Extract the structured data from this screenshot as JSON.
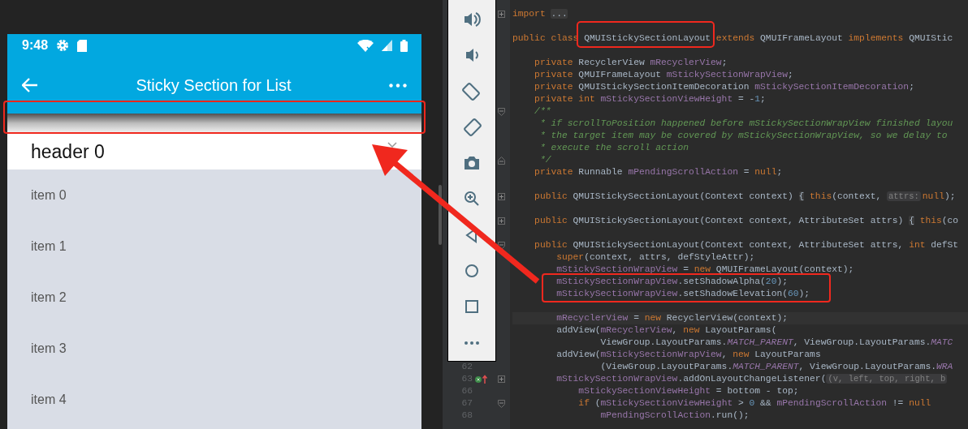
{
  "phone": {
    "status_bar": {
      "time": "9:48"
    },
    "app_bar": {
      "title": "Sticky Section for List"
    },
    "sticky_shadow": {
      "highlighted": true
    },
    "header": {
      "title": "header 0"
    },
    "items": [
      "item 0",
      "item 1",
      "item 2",
      "item 3",
      "item 4"
    ]
  },
  "editor": {
    "lines": [
      {
        "kind": "code",
        "folded": true,
        "tokens": [
          {
            "kind": "kw",
            "text": "import "
          },
          {
            "kind": "folded",
            "text": "..."
          }
        ]
      },
      {
        "kind": "blank"
      },
      {
        "kind": "code",
        "tokens": [
          {
            "kind": "kw",
            "text": "public class "
          },
          {
            "kind": "boxed",
            "text": "QMUIStickySectionLayout"
          },
          {
            "kind": "kw",
            "text": " extends "
          },
          {
            "kind": "txt",
            "text": "QMUIFrameLayout "
          },
          {
            "kind": "kw",
            "text": "implements "
          },
          {
            "kind": "txt",
            "text": "QMUIStic"
          }
        ]
      },
      {
        "kind": "blank"
      },
      {
        "kind": "code",
        "tokens": [
          {
            "kind": "kw",
            "text": "    private "
          },
          {
            "kind": "txt",
            "text": "RecyclerView "
          },
          {
            "kind": "fld",
            "text": "mRecyclerView"
          },
          {
            "kind": "txt",
            "text": ";"
          }
        ]
      },
      {
        "kind": "code",
        "tokens": [
          {
            "kind": "kw",
            "text": "    private "
          },
          {
            "kind": "txt",
            "text": "QMUIFrameLayout "
          },
          {
            "kind": "fld",
            "text": "mStickySectionWrapView"
          },
          {
            "kind": "txt",
            "text": ";"
          }
        ]
      },
      {
        "kind": "code",
        "tokens": [
          {
            "kind": "kw",
            "text": "    private "
          },
          {
            "kind": "txt",
            "text": "QMUIStickySectionItemDecoration "
          },
          {
            "kind": "fld",
            "text": "mStickySectionItemDecoration"
          },
          {
            "kind": "txt",
            "text": ";"
          }
        ]
      },
      {
        "kind": "code",
        "tokens": [
          {
            "kind": "kw",
            "text": "    private int "
          },
          {
            "kind": "fld",
            "text": "mStickySectionViewHeight"
          },
          {
            "kind": "txt",
            "text": " = -"
          },
          {
            "kind": "num",
            "text": "1"
          },
          {
            "kind": "txt",
            "text": ";"
          }
        ]
      },
      {
        "kind": "code",
        "folded": false,
        "tokens": [
          {
            "kind": "cmt",
            "text": "    /**"
          }
        ]
      },
      {
        "kind": "code",
        "tokens": [
          {
            "kind": "cmt",
            "text": "     * if scrollToPosition happened before mStickySectionWrapView finished layou"
          }
        ]
      },
      {
        "kind": "code",
        "tokens": [
          {
            "kind": "cmt",
            "text": "     * the target item may be covered by mStickySectionWrapView, so we delay to"
          }
        ]
      },
      {
        "kind": "code",
        "tokens": [
          {
            "kind": "cmt",
            "text": "     * execute the scroll action"
          }
        ]
      },
      {
        "kind": "code",
        "fold_end": true,
        "tokens": [
          {
            "kind": "cmt",
            "text": "     */"
          }
        ]
      },
      {
        "kind": "code",
        "tokens": [
          {
            "kind": "kw",
            "text": "    private "
          },
          {
            "kind": "txt",
            "text": "Runnable "
          },
          {
            "kind": "fld",
            "text": "mPendingScrollAction"
          },
          {
            "kind": "txt",
            "text": " = "
          },
          {
            "kind": "kw",
            "text": "null"
          },
          {
            "kind": "txt",
            "text": ";"
          }
        ]
      },
      {
        "kind": "blank"
      },
      {
        "kind": "code",
        "folded": true,
        "tokens": [
          {
            "kind": "kw",
            "text": "    public "
          },
          {
            "kind": "txt",
            "text": "QMUIStickySectionLayout(Context context) "
          },
          {
            "kind": "folded",
            "text": "{"
          },
          {
            "kind": "kw",
            "text": " this"
          },
          {
            "kind": "txt",
            "text": "(context, "
          },
          {
            "kind": "hint",
            "text": "attrs:"
          },
          {
            "kind": "kw",
            "text": "null"
          },
          {
            "kind": "txt",
            "text": ");"
          }
        ]
      },
      {
        "kind": "blank"
      },
      {
        "kind": "code",
        "folded": true,
        "tokens": [
          {
            "kind": "kw",
            "text": "    public "
          },
          {
            "kind": "txt",
            "text": "QMUIStickySectionLayout(Context context, AttributeSet attrs) "
          },
          {
            "kind": "folded",
            "text": "{"
          },
          {
            "kind": "kw",
            "text": " this"
          },
          {
            "kind": "txt",
            "text": "(co"
          }
        ]
      },
      {
        "kind": "blank"
      },
      {
        "kind": "code",
        "folded": false,
        "tokens": [
          {
            "kind": "kw",
            "text": "    public "
          },
          {
            "kind": "txt",
            "text": "QMUIStickySectionLayout(Context context, AttributeSet attrs, "
          },
          {
            "kind": "kw",
            "text": "int "
          },
          {
            "kind": "txt",
            "text": "defSt"
          }
        ]
      },
      {
        "kind": "code",
        "tokens": [
          {
            "kind": "kw",
            "text": "        super"
          },
          {
            "kind": "txt",
            "text": "(context, attrs, defStyleAttr);"
          }
        ]
      },
      {
        "kind": "code",
        "tokens": [
          {
            "kind": "fld",
            "text": "        mStickySectionWrapView"
          },
          {
            "kind": "txt",
            "text": " = "
          },
          {
            "kind": "kw",
            "text": "new "
          },
          {
            "kind": "txt",
            "text": "QMUIFrameLayout(context);"
          }
        ]
      },
      {
        "kind": "boxed-group",
        "lines": [
          {
            "kind": "code",
            "tokens": [
              {
                "kind": "fld",
                "text": "        mStickySectionWrapView"
              },
              {
                "kind": "txt",
                "text": ".setShadowAlpha("
              },
              {
                "kind": "num",
                "text": "20"
              },
              {
                "kind": "txt",
                "text": ");"
              }
            ]
          },
          {
            "kind": "code",
            "tokens": [
              {
                "kind": "fld",
                "text": "        mStickySectionWrapView"
              },
              {
                "kind": "txt",
                "text": ".setShadowElevation("
              },
              {
                "kind": "num",
                "text": "60"
              },
              {
                "kind": "txt",
                "text": ");"
              }
            ]
          }
        ]
      },
      {
        "kind": "blank"
      },
      {
        "kind": "code",
        "current": true,
        "tokens": [
          {
            "kind": "fld",
            "text": "        mRecyclerView"
          },
          {
            "kind": "txt",
            "text": " = "
          },
          {
            "kind": "kw",
            "text": "new "
          },
          {
            "kind": "txt",
            "text": "RecyclerView(context);"
          }
        ]
      },
      {
        "kind": "code",
        "tokens": [
          {
            "kind": "txt",
            "text": "        addView("
          },
          {
            "kind": "fld",
            "text": "mRecyclerView"
          },
          {
            "kind": "txt",
            "text": ", "
          },
          {
            "kind": "kw",
            "text": "new "
          },
          {
            "kind": "txt",
            "text": "LayoutParams("
          }
        ]
      },
      {
        "kind": "code",
        "tokens": [
          {
            "kind": "txt",
            "text": "                ViewGroup.LayoutParams."
          },
          {
            "kind": "const",
            "text": "MATCH_PARENT"
          },
          {
            "kind": "txt",
            "text": ", ViewGroup.LayoutParams."
          },
          {
            "kind": "const",
            "text": "MATC"
          }
        ]
      },
      {
        "kind": "code",
        "tokens": [
          {
            "kind": "txt",
            "text": "        addView("
          },
          {
            "kind": "fld",
            "text": "mStickySectionWrapView"
          },
          {
            "kind": "txt",
            "text": ", "
          },
          {
            "kind": "kw",
            "text": "new "
          },
          {
            "kind": "txt",
            "text": "LayoutParams"
          }
        ]
      },
      {
        "kind": "code",
        "number": "62",
        "tokens": [
          {
            "kind": "txt",
            "text": "                (ViewGroup.LayoutParams."
          },
          {
            "kind": "const",
            "text": "MATCH_PARENT"
          },
          {
            "kind": "txt",
            "text": ", ViewGroup.LayoutParams."
          },
          {
            "kind": "const",
            "text": "WRA"
          }
        ]
      },
      {
        "kind": "code",
        "number": "63",
        "overridden": true,
        "folded": true,
        "tokens": [
          {
            "kind": "fld",
            "text": "        mStickySectionWrapView"
          },
          {
            "kind": "txt",
            "text": ".addOnLayoutChangeListener("
          },
          {
            "kind": "hint",
            "text": "(v, left, top, right, b"
          }
        ]
      },
      {
        "kind": "code",
        "number": "66",
        "tokens": [
          {
            "kind": "fld",
            "text": "            mStickySectionViewHeight"
          },
          {
            "kind": "txt",
            "text": " = bottom - top;"
          }
        ]
      },
      {
        "kind": "code",
        "number": "67",
        "folded": false,
        "tokens": [
          {
            "kind": "kw",
            "text": "            if "
          },
          {
            "kind": "txt",
            "text": "("
          },
          {
            "kind": "fld",
            "text": "mStickySectionViewHeight"
          },
          {
            "kind": "txt",
            "text": " > "
          },
          {
            "kind": "num",
            "text": "0"
          },
          {
            "kind": "txt",
            "text": " && "
          },
          {
            "kind": "fld",
            "text": "mPendingScrollAction"
          },
          {
            "kind": "txt",
            "text": " != "
          },
          {
            "kind": "kw",
            "text": "null"
          }
        ]
      },
      {
        "kind": "code",
        "number": "68",
        "tokens": [
          {
            "kind": "fld",
            "text": "                mPendingScrollAction"
          },
          {
            "kind": "txt",
            "text": ".run();"
          }
        ]
      }
    ]
  }
}
